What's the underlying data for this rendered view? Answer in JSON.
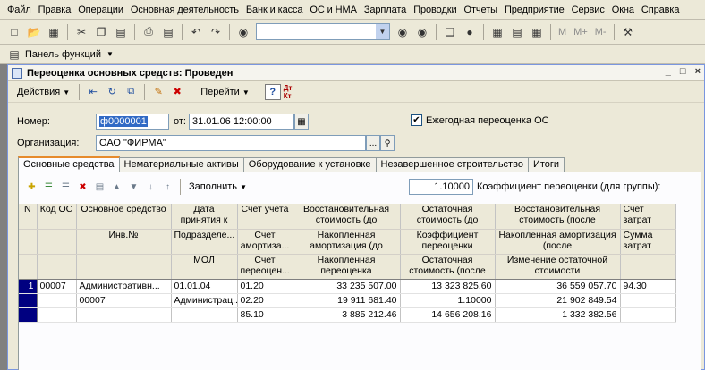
{
  "menu": [
    "Файл",
    "Правка",
    "Операции",
    "Основная деятельность",
    "Банк и касса",
    "ОС и НМА",
    "Зарплата",
    "Проводки",
    "Отчеты",
    "Предприятие",
    "Сервис",
    "Окна",
    "Справка"
  ],
  "toolbar_letters": [
    "M",
    "M+",
    "M-"
  ],
  "panel_label": "Панель функций",
  "window": {
    "title": "Переоценка основных средств: Проведен",
    "controls": [
      "_",
      "□",
      "×"
    ]
  },
  "actions": {
    "actions_label": "Действия",
    "goto_label": "Перейти",
    "help_label": "?",
    "dt_kt": "Дт Кт"
  },
  "form": {
    "number_label": "Номер:",
    "number_value": "ф0000001",
    "from_label": "от:",
    "date_value": "31.01.06 12:00:00",
    "annual_label": "Ежегодная переоценка ОС",
    "annual_checked": true,
    "org_label": "Организация:",
    "org_value": "ОАО \"ФИРМА\"",
    "ellipsis": "...",
    "search_glyph": "🔍"
  },
  "tabs": [
    "Основные средства",
    "Нематериальные активы",
    "Оборудование к установке",
    "Незавершенное строительство",
    "Итоги"
  ],
  "gridbar": {
    "fill_label": "Заполнить",
    "coef_value": "1.10000",
    "coef_label": "Коэффициент переоценки (для группы):"
  },
  "table": {
    "headers": [
      [
        "N",
        "Код ОС",
        "Основное средство",
        "Дата принятия к",
        "Счет учета",
        "Восстановительная стоимость (до",
        "Остаточная стоимость (до",
        "Восстановительная стоимость (после",
        "Счет затрат"
      ],
      [
        "",
        "",
        "Инв.№",
        "Подразделе...",
        "Счет амортиза...",
        "Накопленная амортизация (до",
        "Коэффициент переоценки",
        "Накопленная амортизация (после",
        "Сумма затрат"
      ],
      [
        "",
        "",
        "",
        "МОЛ",
        "Счет переоцен...",
        "Накопленная переоценка",
        "Остаточная стоимость (после",
        "Изменение остаточной стоимости",
        ""
      ]
    ],
    "rows": [
      [
        "1",
        "00007",
        "Административн...",
        "01.01.04",
        "01.20",
        "33 235 507.00",
        "13 323 825.60",
        "36 559 057.70",
        "94.30"
      ],
      [
        "",
        "",
        "00007",
        "Администрац...",
        "02.20",
        "19 911 681.40",
        "1.10000",
        "21 902 849.54",
        ""
      ],
      [
        "",
        "",
        "",
        "",
        "85.10",
        "3 885 212.46",
        "14 656 208.16",
        "1 332 382.56",
        ""
      ]
    ]
  }
}
